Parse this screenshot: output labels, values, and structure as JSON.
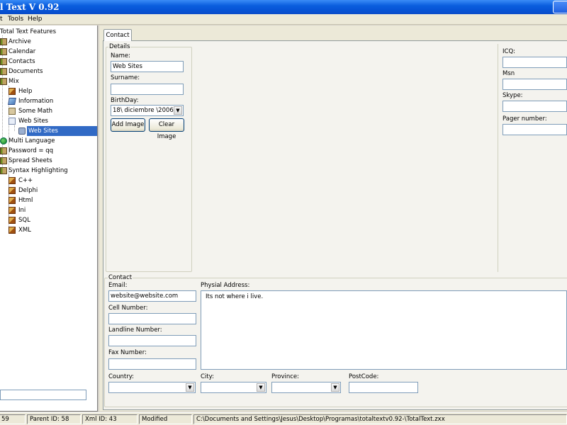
{
  "window": {
    "title": "l Text V 0.92"
  },
  "menu": {
    "items": [
      "t",
      "Tools",
      "Help"
    ]
  },
  "tree": {
    "items": [
      {
        "label": "Total Text Features",
        "icon": "globe-icon"
      },
      {
        "label": "Archive",
        "icon": "book-icon"
      },
      {
        "label": "Calendar",
        "icon": "book-icon"
      },
      {
        "label": "Contacts",
        "icon": "book-icon"
      },
      {
        "label": "Documents",
        "icon": "book-icon"
      },
      {
        "label": "Mix",
        "icon": "book-icon"
      },
      {
        "label": "Help",
        "icon": "pen-icon"
      },
      {
        "label": "Information",
        "icon": "info-icon"
      },
      {
        "label": "Some Math",
        "icon": "calc-icon"
      },
      {
        "label": "Web Sites",
        "icon": "page-icon"
      },
      {
        "label": "Web Sites",
        "icon": "link-icon"
      },
      {
        "label": "Multi Language",
        "icon": "globe-icon"
      },
      {
        "label": "Password = qq",
        "icon": "book-icon"
      },
      {
        "label": "Spread Sheets",
        "icon": "book-icon"
      },
      {
        "label": "Syntax Highlighting",
        "icon": "book-icon"
      },
      {
        "label": "C++",
        "icon": "pen-icon"
      },
      {
        "label": "Delphi",
        "icon": "pen-icon"
      },
      {
        "label": "Html",
        "icon": "pen-icon"
      },
      {
        "label": "Ini",
        "icon": "pen-icon"
      },
      {
        "label": "SQL",
        "icon": "pen-icon"
      },
      {
        "label": "XML",
        "icon": "pen-icon"
      }
    ],
    "search_value": ""
  },
  "tabs": [
    {
      "label": "Contact"
    }
  ],
  "details": {
    "group_title": "Details",
    "name_label": "Name:",
    "name_value": "Web Sites",
    "surname_label": "Surname:",
    "surname_value": "",
    "birthday_label": "BirthDay:",
    "birthday_value": "18\\ diciembre \\2006",
    "add_image": "Add Image",
    "clear_image": "Clear Image"
  },
  "im": {
    "icq_label": "ICQ:",
    "icq_value": "",
    "msn_label": "Msn",
    "msn_value": "",
    "skype_label": "Skype:",
    "skype_value": "",
    "pager_label": "Pager number:",
    "pager_value": ""
  },
  "contact": {
    "group_title": "Contact",
    "email_label": "Email:",
    "email_value": "website@website.com",
    "cell_label": "Cell Number:",
    "cell_value": "",
    "landline_label": "Landline Number:",
    "landline_value": "",
    "fax_label": "Fax Number:",
    "fax_value": "",
    "address_label": "Physial Address:",
    "address_value": "Its not where i live.",
    "country_label": "Country:",
    "country_value": "",
    "city_label": "City:",
    "city_value": "",
    "province_label": "Province:",
    "province_value": "",
    "postcode_label": "PostCode:",
    "postcode_value": ""
  },
  "status": {
    "id": "59",
    "parent": "Parent ID: 58",
    "xml": "Xml ID: 43",
    "state": "Modified",
    "path": "C:\\Documents and Settings\\Jesus\\Desktop\\Programas\\totaltextv0.92-\\TotalText.zxx"
  }
}
